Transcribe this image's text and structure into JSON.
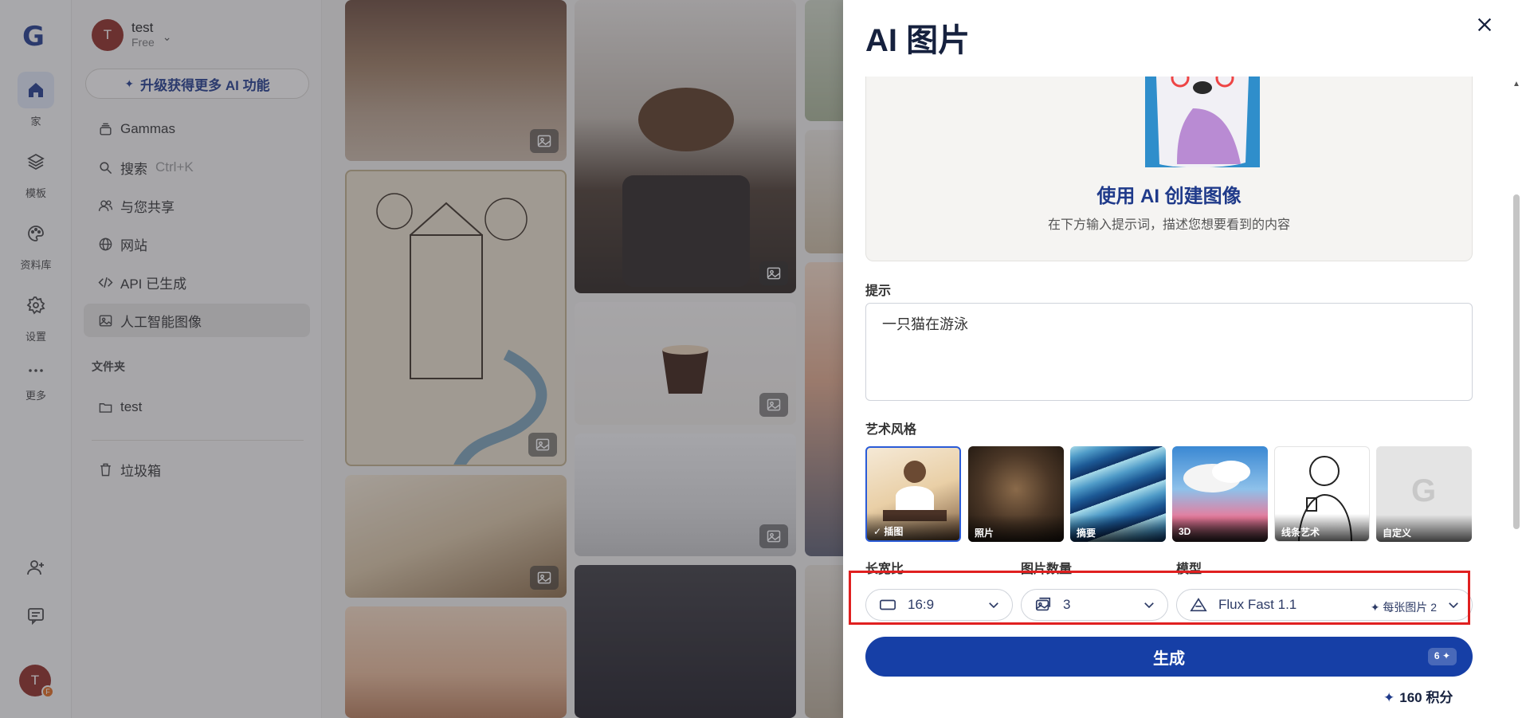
{
  "rail": {
    "items": [
      {
        "label": "家",
        "icon": "home-icon"
      },
      {
        "label": "模板",
        "icon": "layers-icon"
      },
      {
        "label": "资料库",
        "icon": "palette-icon"
      },
      {
        "label": "设置",
        "icon": "gear-icon"
      },
      {
        "label": "更多",
        "icon": "more-icon"
      }
    ],
    "avatar_letter": "T",
    "avatar_badge": "F"
  },
  "sidebar": {
    "workspace_name": "test",
    "workspace_plan": "Free",
    "avatar_letter": "T",
    "upgrade_label": "升级获得更多 AI 功能",
    "nav": [
      {
        "label": "Gammas"
      },
      {
        "label": "搜索",
        "hint": "Ctrl+K"
      },
      {
        "label": "与您共享"
      },
      {
        "label": "网站"
      },
      {
        "label": "API 已生成"
      },
      {
        "label": "人工智能图像"
      }
    ],
    "folders_title": "文件夹",
    "folders": [
      {
        "label": "test"
      }
    ],
    "trash_label": "垃圾箱"
  },
  "drawer": {
    "title": "AI 图片",
    "hero_heading": "使用 AI 创建图像",
    "hero_subtext": "在下方输入提示词，描述您想要看到的内容",
    "prompt_label": "提示",
    "prompt_value": "一只猫在游泳",
    "style_label": "艺术风格",
    "styles": [
      {
        "label": "插图",
        "selected": true
      },
      {
        "label": "照片",
        "selected": false
      },
      {
        "label": "摘要",
        "selected": false
      },
      {
        "label": "3D",
        "selected": false
      },
      {
        "label": "线条艺术",
        "selected": false
      },
      {
        "label": "自定义",
        "selected": false
      }
    ],
    "aspect_label": "长宽比",
    "aspect_value": "16:9",
    "count_label": "图片数量",
    "count_value": "3",
    "model_label": "模型",
    "model_value": "Flux Fast 1.1",
    "per_image_text": "每张图片",
    "per_image_cost": "2",
    "generate_label": "生成",
    "generate_cost": "6",
    "credits_text": "160 积分",
    "accent_color": "#163fa6",
    "highlight_color": "#e02020"
  }
}
